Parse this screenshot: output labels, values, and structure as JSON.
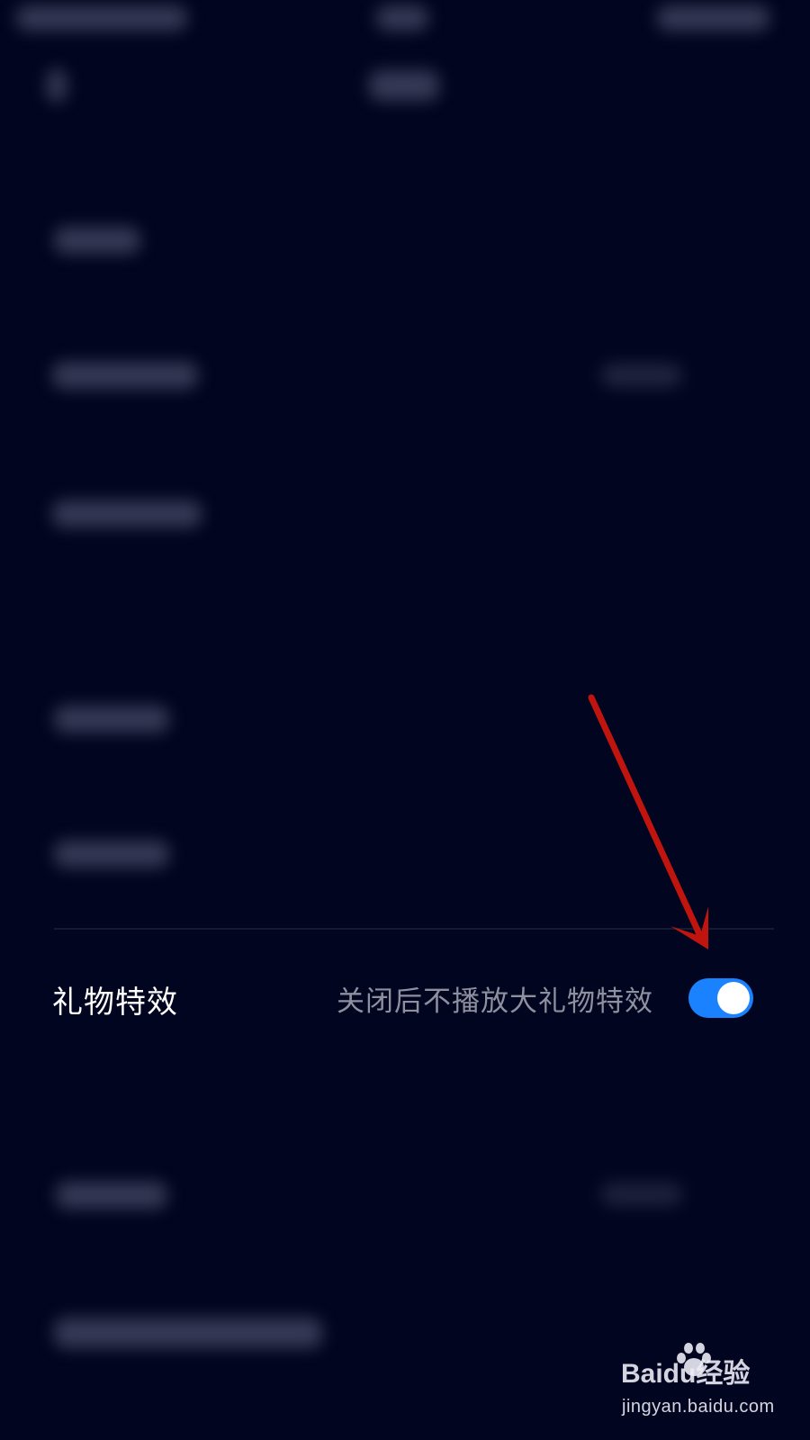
{
  "settings_item": {
    "title": "礼物特效",
    "description": "关闭后不播放大礼物特效",
    "toggle_on": true
  },
  "watermark": {
    "logo_text": "Baidu经验",
    "url": "jingyan.baidu.com"
  },
  "colors": {
    "background": "#01051f",
    "toggle_on": "#1a82ff",
    "annotation_arrow": "#c0140e",
    "description_text": "#8f909f"
  }
}
